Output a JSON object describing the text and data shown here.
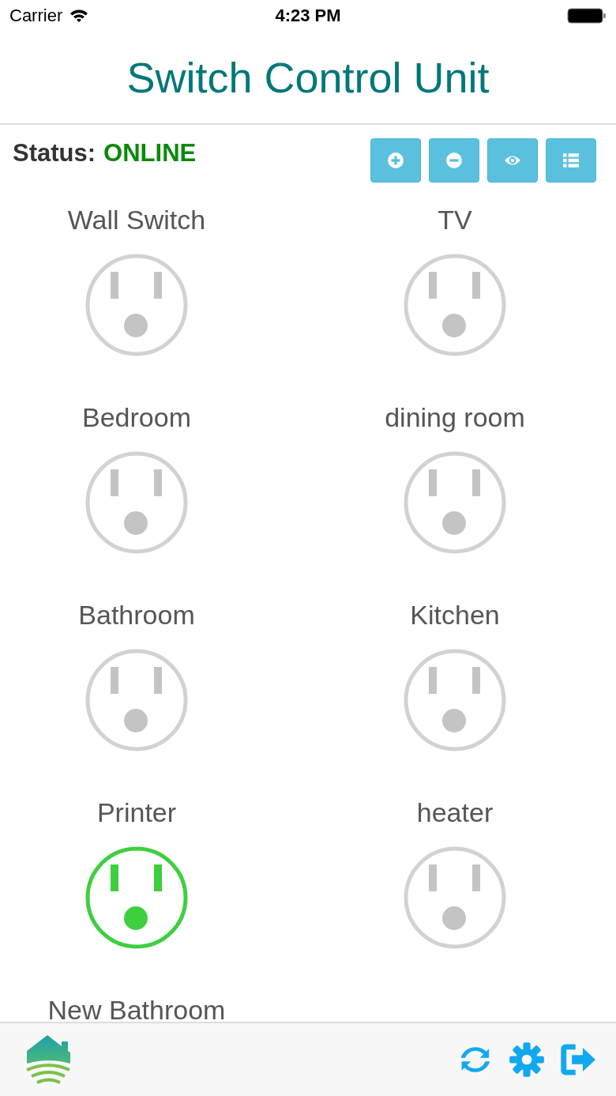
{
  "status_bar": {
    "carrier": "Carrier",
    "time": "4:23 PM"
  },
  "title": "Switch Control Unit",
  "status": {
    "label": "Status:",
    "value": "ONLINE"
  },
  "toolbar": [
    {
      "kind": "add"
    },
    {
      "kind": "remove"
    },
    {
      "kind": "view"
    },
    {
      "kind": "list"
    }
  ],
  "outlets": [
    {
      "name": "Wall Switch",
      "on": false
    },
    {
      "name": "TV",
      "on": false
    },
    {
      "name": "Bedroom",
      "on": false
    },
    {
      "name": "dining room",
      "on": false
    },
    {
      "name": "Bathroom",
      "on": false
    },
    {
      "name": "Kitchen",
      "on": false
    },
    {
      "name": "Printer",
      "on": true
    },
    {
      "name": "heater",
      "on": false
    },
    {
      "name": "New Bathroom"
    }
  ],
  "footer": [
    {
      "kind": "refresh"
    },
    {
      "kind": "settings"
    },
    {
      "kind": "logout"
    }
  ]
}
